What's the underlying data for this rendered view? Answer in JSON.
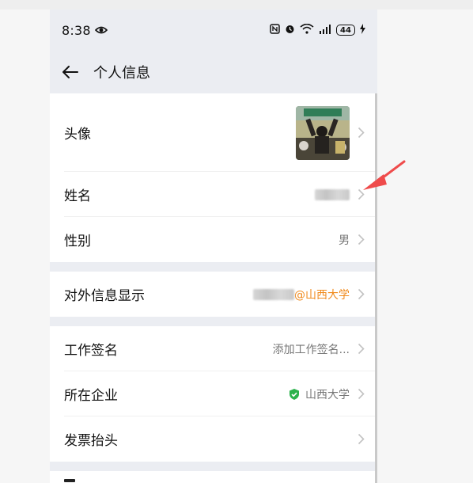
{
  "status": {
    "time": "8:38",
    "battery": "44"
  },
  "nav": {
    "title": "个人信息"
  },
  "rows": {
    "avatar": {
      "label": "头像"
    },
    "name": {
      "label": "姓名"
    },
    "gender": {
      "label": "性别",
      "value": "男"
    },
    "external": {
      "label": "对外信息显示",
      "value": "@山西大学"
    },
    "signature": {
      "label": "工作签名",
      "value": "添加工作签名..."
    },
    "company": {
      "label": "所在企业",
      "value": "山西大学"
    },
    "invoice": {
      "label": "发票抬头"
    }
  },
  "colors": {
    "accent_orange": "#f08a1c",
    "verified_green": "#2bb24c",
    "annotation_red": "#ef4b4b"
  }
}
